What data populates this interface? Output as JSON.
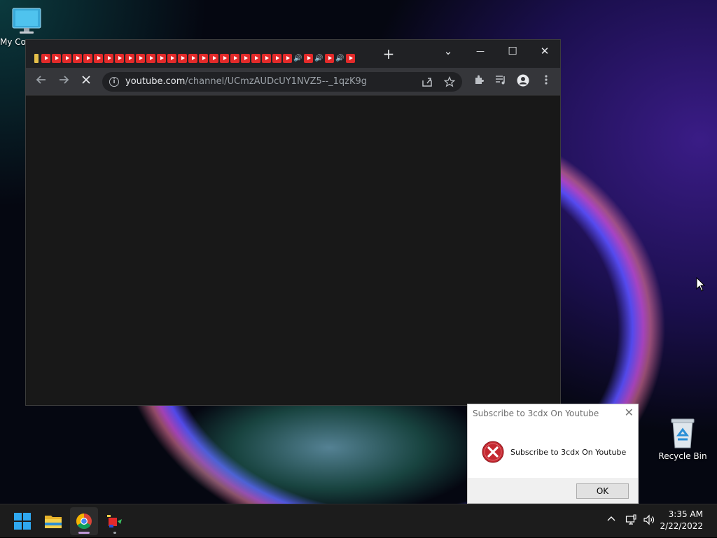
{
  "desktop": {
    "icons": [
      {
        "label": "My Co"
      },
      {
        "label": "Recycle Bin"
      }
    ]
  },
  "browser": {
    "tabs": {
      "favicons": [
        "lock",
        "yt",
        "yt",
        "yt",
        "yt",
        "yt",
        "yt",
        "yt",
        "yt",
        "yt",
        "yt",
        "yt",
        "yt",
        "yt",
        "yt",
        "yt",
        "yt",
        "yt",
        "yt",
        "yt",
        "yt",
        "yt",
        "yt",
        "yt",
        "yt",
        "aud",
        "yt",
        "aud",
        "yt",
        "aud",
        "yt"
      ]
    },
    "new_tab": "+",
    "window_controls": {
      "dropdown": "⌄",
      "minimize": "—",
      "maximize": "☐",
      "close": "✕"
    },
    "address": {
      "host": "youtube.com",
      "path": "/channel/UCmzAUDcUY1NVZ5--_1qzK9g"
    },
    "toolbar_icons": [
      "arrow-left-icon",
      "arrow-right-icon",
      "stop-icon",
      "share-icon",
      "star-icon",
      "extensions-icon",
      "media-icon",
      "profile-icon",
      "menu-icon"
    ]
  },
  "dialog": {
    "title": "Subscribe to 3cdx On Youtube",
    "message": "Subscribe to 3cdx On Youtube",
    "ok_label": "OK"
  },
  "taskbar": {
    "apps": [
      "start-icon",
      "file-explorer-icon",
      "chrome-icon",
      "app-icon"
    ],
    "time": "3:35 AM",
    "date": "2/22/2022"
  },
  "colors": {
    "youtube_red": "#e32a2a",
    "dialog_error_red": "#c4272f"
  }
}
